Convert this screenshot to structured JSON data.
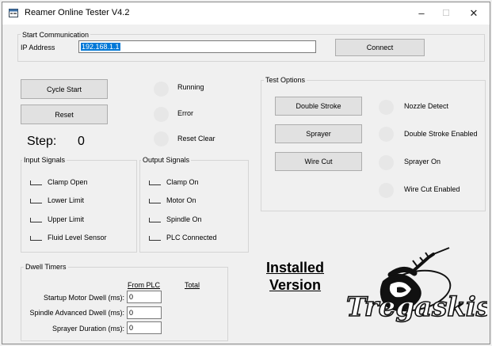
{
  "app": {
    "title": "Reamer Online Tester V4.2",
    "minimize": "–",
    "maximize": "☐",
    "close": "✕"
  },
  "communication": {
    "group_label": "Start Communication",
    "ip_label": "IP Address",
    "ip_value": "192.168.1.1",
    "connect_label": "Connect"
  },
  "controls": {
    "cycle_start": "Cycle Start",
    "reset": "Reset",
    "step_label": "Step:",
    "step_value": "0"
  },
  "status": {
    "running": "Running",
    "error": "Error",
    "reset_clear": "Reset Clear"
  },
  "input_signals": {
    "label": "Input Signals",
    "items": [
      "Clamp Open",
      "Lower Limit",
      "Upper Limit",
      "Fluid Level Sensor"
    ]
  },
  "output_signals": {
    "label": "Output Signals",
    "items": [
      "Clamp On",
      "Motor On",
      "Spindle On",
      "PLC Connected"
    ]
  },
  "test_options": {
    "label": "Test Options",
    "buttons": [
      "Double Stroke",
      "Sprayer",
      "Wire Cut"
    ],
    "indicators": [
      "Nozzle Detect",
      "Double Stroke Enabled",
      "Sprayer On",
      "Wire Cut Enabled"
    ]
  },
  "dwell": {
    "label": "Dwell Timers",
    "col_from_plc": "From PLC",
    "col_total": "Total",
    "rows": [
      {
        "label": "Startup Motor Dwell (ms):",
        "value": "0"
      },
      {
        "label": "Spindle Advanced Dwell (ms):",
        "value": "0"
      },
      {
        "label": "Sprayer Duration (ms):",
        "value": "0"
      }
    ]
  },
  "installed": {
    "line1": "Installed",
    "line2": "Version"
  },
  "logo": {
    "text": "Tregaskiss"
  }
}
